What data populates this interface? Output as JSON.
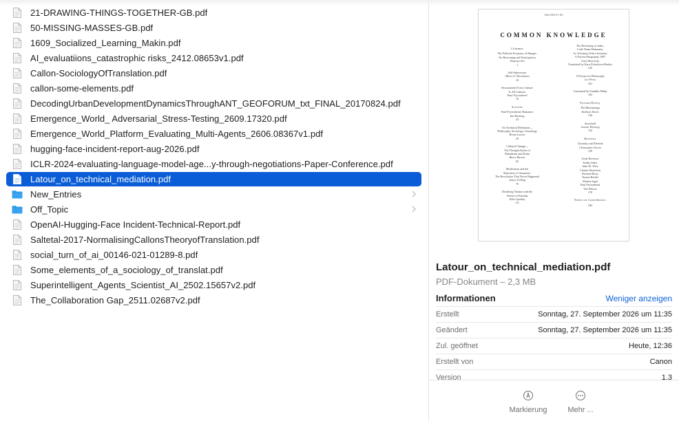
{
  "files": [
    {
      "name": "21-DRAWING-THINGS-TOGETHER-GB.pdf",
      "kind": "pdf"
    },
    {
      "name": "50-MISSING-MASSES-GB.pdf",
      "kind": "pdf"
    },
    {
      "name": "1609_Socialized_Learning_Makin.pdf",
      "kind": "pdf"
    },
    {
      "name": "AI_evaluatiions_catastrophic risks_2412.08653v1.pdf",
      "kind": "pdf"
    },
    {
      "name": "Callon-SociologyOfTranslation.pdf",
      "kind": "pdf"
    },
    {
      "name": "callon-some-elements.pdf",
      "kind": "pdf"
    },
    {
      "name": "DecodingUrbanDevelopmentDynamicsThroughANT_GEOFORUM_txt_FINAL_20170824.pdf",
      "kind": "pdf"
    },
    {
      "name": "Emergence_World_ Adversarial_Stress-Testing_2609.17320.pdf",
      "kind": "pdf"
    },
    {
      "name": "Emergence_World_Platform_Evaluating_Multi-Agents_2606.08367v1.pdf",
      "kind": "pdf"
    },
    {
      "name": "hugging-face-incident-report-aug-2026.pdf",
      "kind": "pdf"
    },
    {
      "name": "ICLR-2024-evaluating-language-model-age...y-through-negotiations-Paper-Conference.pdf",
      "kind": "pdf"
    },
    {
      "name": "Latour_on_technical_mediation.pdf",
      "kind": "pdf",
      "selected": true
    },
    {
      "name": "New_Entries",
      "kind": "folder"
    },
    {
      "name": "Off_Topic",
      "kind": "folder"
    },
    {
      "name": "OpenAI-Hugging-Face Incident-Technical-Report.pdf",
      "kind": "pdf"
    },
    {
      "name": "Saltetal-2017-NormalisingCallonsTheoryofTranslation.pdf",
      "kind": "pdf"
    },
    {
      "name": "social_turn_of_ai_00146-021-01289-8.pdf",
      "kind": "pdf"
    },
    {
      "name": "Some_elements_of_a_sociology_of_translat.pdf",
      "kind": "pdf"
    },
    {
      "name": "Superintelligent_Agents_Scientist_AI_2502.15657v2.pdf",
      "kind": "pdf"
    },
    {
      "name": "The_Collaboration Gap_2511.02687v2.pdf",
      "kind": "pdf"
    }
  ],
  "preview": {
    "page_header": "Fall 1994 V1 N3",
    "page_title": "COMMON KNOWLEDGE",
    "left_column": [
      {
        "h": "Columns"
      },
      {
        "t": "The Political Economy of Hunger:",
        "t2": "On Reasoning and Participation",
        "a": "Amartya Sen",
        "p": "1"
      },
      {
        "t": "Self-Subversion",
        "a": "Albert O. Hirschman",
        "p": "10"
      },
      {
        "t": "Passionately Every Culture",
        "t2": "Is All Cultures",
        "a": "Paul Feyerabend",
        "p": "16"
      },
      {
        "h": "Articles"
      },
      {
        "t": "Paul Feyerabend, Humanist",
        "a": "Ian Hacking",
        "p": "23"
      },
      {
        "t": "On Technical Mediation—",
        "t2": "Philosophy, Sociology, Genealogy",
        "a": "Bruno Latour",
        "p": "29"
      },
      {
        "t": "Cultural Change—",
        "t2": "The Thought-Styles of",
        "t3": "Mannheim and Kuhn",
        "a": "Barry Barnes",
        "p": "65"
      },
      {
        "t": "Modernism and the",
        "t2": "Rejection of Ornament:",
        "t3": "The Revolution That Never Happened",
        "a": "James Trilling",
        "p": "79"
      },
      {
        "t": "Deathwig Thomas and the",
        "t2": "Senses of Kinship",
        "a": "Ellen Spolsky",
        "p": "111"
      }
    ],
    "right_column": [
      {
        "t": "The Revisiting of Jatko,",
        "t2": "Code Name Humanist,",
        "t3": "As Voluntary Police Informer",
        "t4": "A Psycho-Biography 1997",
        "a": "Josef Skvorecky",
        "t5": "Translated by Kaca Polackova-Henley",
        "p": "145"
      },
      {
        "t": "A Picture for Philosophy",
        "a": "Lev Perty",
        "p": "161"
      },
      {
        "t": "Translated by Franklin Philip",
        "p": "163"
      },
      {
        "h": "Fiction/Poetry"
      },
      {
        "t": "The Bluesmongs",
        "a": "Kathryn Davis",
        "p": "130"
      },
      {
        "t": "Snowball",
        "a": "Joanne Hearing",
        "p": "142"
      },
      {
        "h": "Reviews"
      },
      {
        "t": "Chomsky and Derrida",
        "a": "Christopher Norris",
        "p": "159"
      },
      {
        "t": "Little Reviews",
        "a": "Richard Rorty",
        "t2": "Kathy Eden",
        "t3": "John M. Wise",
        "t4": "Charles Bernstein",
        "t5": "Naomi Reidel",
        "t6": "Marina Ingal",
        "t7": "Paul Feyerabend",
        "t8": "The Editors",
        "p": "170"
      },
      {
        "h": "Notes on Contributors"
      },
      {
        "p": "182"
      }
    ]
  },
  "info": {
    "doc_title": "Latour_on_technical_mediation.pdf",
    "doc_subtitle": "PDF-Dokument – 2,3 MB",
    "section_title": "Informationen",
    "toggle_label": "Weniger anzeigen",
    "rows": [
      {
        "k": "Erstellt",
        "v": "Sonntag, 27. September 2026 um 11:35"
      },
      {
        "k": "Geändert",
        "v": "Sonntag, 27. September 2026 um 11:35"
      },
      {
        "k": "Zul. geöffnet",
        "v": "Heute, 12:36"
      },
      {
        "k": "Erstellt von",
        "v": "Canon"
      },
      {
        "k": "Version",
        "v": "1.3"
      }
    ]
  },
  "actions": [
    {
      "label": "Markierung",
      "icon": "markup-icon"
    },
    {
      "label": "Mehr ...",
      "icon": "more-icon"
    }
  ],
  "colors": {
    "selection": "#0a5dd6",
    "folder": "#3aa3ef",
    "link": "#0a60d9"
  }
}
